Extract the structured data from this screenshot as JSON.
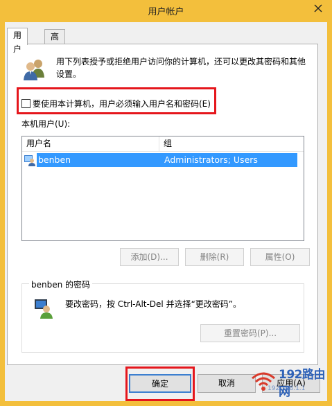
{
  "window": {
    "title": "用户帐户"
  },
  "tabs": [
    {
      "label": "用户",
      "active": true
    },
    {
      "label": "高级",
      "active": false
    }
  ],
  "intro_text": "用下列表授予或拒绝用户访问你的计算机，还可以更改其密码和其他设置。",
  "require_login": {
    "label": "要使用本计算机，用户必须输入用户名和密码(E)",
    "checked": false
  },
  "local_users_label": "本机用户(U):",
  "users_table": {
    "columns": [
      "用户名",
      "组"
    ],
    "rows": [
      {
        "name": "benben",
        "group": "Administrators; Users",
        "selected": true
      }
    ]
  },
  "buttons": {
    "add": "添加(D)...",
    "remove": "删除(R)",
    "properties": "属性(O)"
  },
  "password_group": {
    "title": "benben 的密码",
    "text": "要改密码，按 Ctrl-Alt-Del 并选择“更改密码”。",
    "reset_button": "重置密码(P)..."
  },
  "footer": {
    "ok": "确定",
    "cancel": "取消",
    "apply": "应用(A)"
  },
  "watermark": {
    "text": "192路由网",
    "sub": "192.168.1.1"
  },
  "colors": {
    "titlebar": "#f3bf3c",
    "selection": "#3399ff",
    "highlight_box": "#e5161c"
  }
}
